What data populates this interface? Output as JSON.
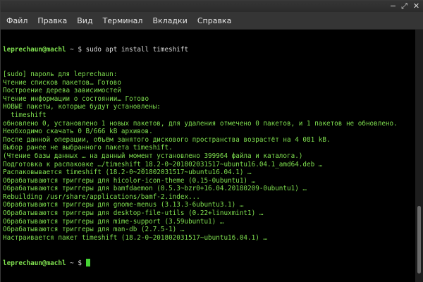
{
  "menubar": {
    "items": [
      "Файл",
      "Правка",
      "Вид",
      "Терминал",
      "Вкладки",
      "Справка"
    ]
  },
  "window_controls": {
    "minimize": "−",
    "maximize": "⤢",
    "close": "✕"
  },
  "terminal": {
    "prompt1": {
      "user": "leprechaun@machl",
      "sep": " ~ $ ",
      "command": "sudo apt install timeshift"
    },
    "output": [
      "[sudo] пароль для leprechaun:",
      "Чтение списков пакетов… Готово",
      "Построение дерева зависимостей",
      "Чтение информации о состоянии… Готово",
      "НОВЫЕ пакеты, которые будут установлены:",
      "  timeshift",
      "обновлено 0, установлено 1 новых пакетов, для удаления отмечено 0 пакетов, и 1 пакетов не обновлено.",
      "Необходимо скачать 0 B/666 kB архивов.",
      "После данной операции, объём занятого дискового пространства возрастёт на 4 081 kB.",
      "Выбор ранее не выбранного пакета timeshift.",
      "(Чтение базы данных … на данный момент установлено 399964 файла и каталога.)",
      "Подготовка к распаковке …/timeshift_18.2-0~201802031517~ubuntu16.04.1_amd64.deb …",
      "Распаковывается timeshift (18.2-0~201802031517~ubuntu16.04.1) …",
      "Обрабатываются триггеры для hicolor-icon-theme (0.15-0ubuntu1) …",
      "Обрабатываются триггеры для bamfdaemon (0.5.3~bzr0+16.04.20180209-0ubuntu1) …",
      "Rebuilding /usr/share/applications/bamf-2.index...",
      "Обрабатываются триггеры для gnome-menus (3.13.3-6ubuntu3.1) …",
      "Обрабатываются триггеры для desktop-file-utils (0.22+linuxmint1) …",
      "Обрабатываются триггеры для mime-support (3.59ubuntu1) …",
      "Обрабатываются триггеры для man-db (2.7.5-1) …",
      "Настраивается пакет timeshift (18.2-0~201802031517~ubuntu16.04.1) …"
    ],
    "prompt2": {
      "user": "leprechaun@machl",
      "sep": " ~ $ "
    }
  }
}
